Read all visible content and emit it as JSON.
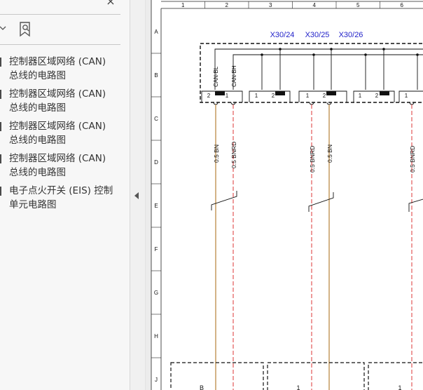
{
  "sidebar": {
    "close_glyph": "×",
    "bookmarks": [
      {
        "line1": "控制器区域网络 (CAN)",
        "line2": "总线的电路图"
      },
      {
        "line1": "控制器区域网络 (CAN)",
        "line2": "总线的电路图"
      },
      {
        "line1": "控制器区域网络 (CAN)",
        "line2": "总线的电路图"
      },
      {
        "line1": "控制器区域网络 (CAN)",
        "line2": "总线的电路图"
      },
      {
        "line1": "电子点火开关 (EIS) 控制",
        "line2": "单元电路图"
      }
    ]
  },
  "schematic": {
    "columns": [
      "1",
      "2",
      "3",
      "4",
      "5",
      "6"
    ],
    "rows": [
      "A",
      "B",
      "C",
      "D",
      "E",
      "F",
      "G",
      "H",
      "J"
    ],
    "connectors": [
      "X30/24",
      "X30/25",
      "X30/26"
    ],
    "can_labels": [
      "CAN-BL",
      "CAN-BH"
    ],
    "pins": [
      "2",
      "1",
      "1",
      "2",
      "1",
      "2",
      "1",
      "2",
      "1"
    ],
    "wire_labels": [
      "0.5 BN",
      "0.5 BNRD",
      "0.5 BNRD",
      "0.5 BN",
      "0.5 BNRD"
    ],
    "bottom_labels": [
      "B",
      "1",
      "1"
    ],
    "colors": {
      "wire_bn": "#c8a068",
      "wire_rd": "#e04848",
      "connector_label": "#1f1fc8",
      "frame": "#222222"
    }
  }
}
